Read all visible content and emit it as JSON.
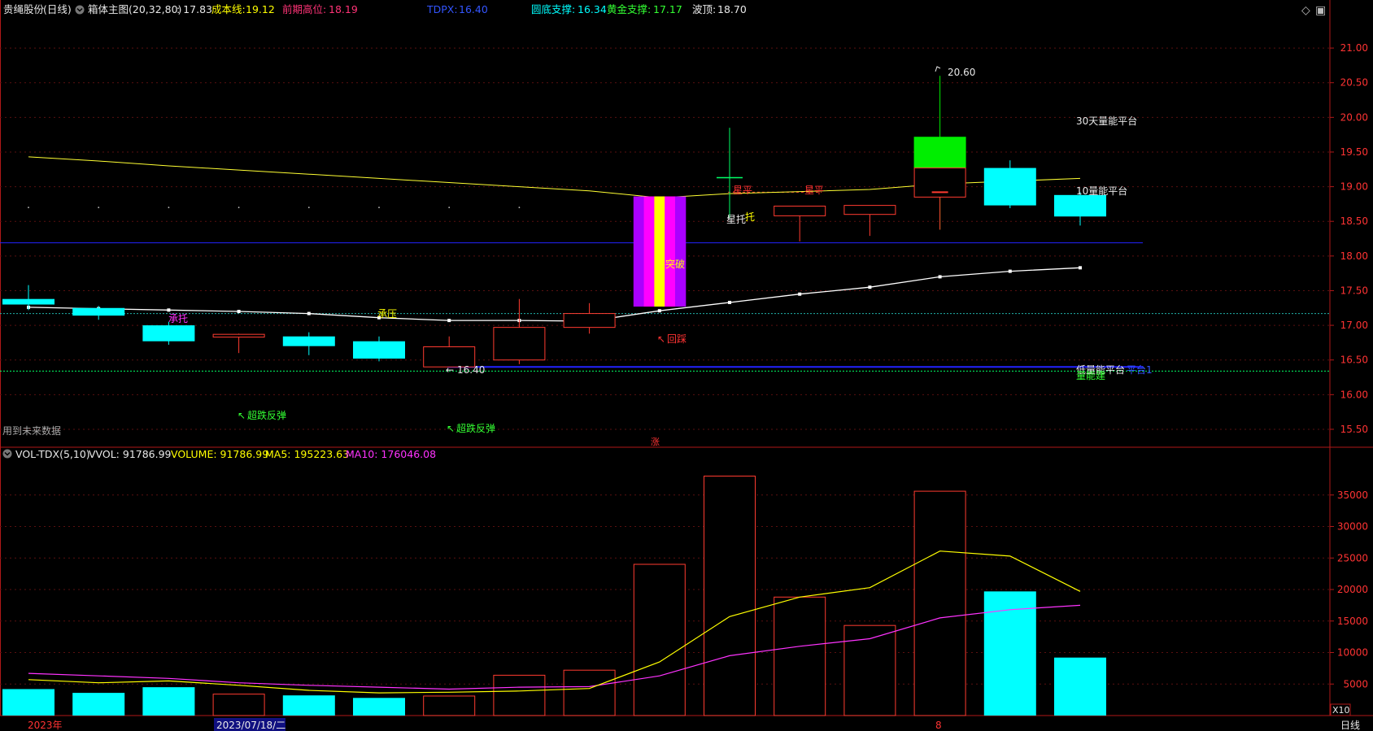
{
  "colors": {
    "bg": "#000000",
    "frame": "#b01818",
    "grid": "#5a1010",
    "up": "#ff3b30",
    "down": "#00ffff",
    "ma_price": "#ffffff",
    "cost_line": "#ffff33",
    "vol_ma5": "#ffff00",
    "vol_ma10": "#ff33ff",
    "support_line": "#00ff66",
    "blue_line": "#2222ff",
    "teal_line": "#20b2aa",
    "text_white": "#e8e8e8",
    "text_yellow": "#ffff00",
    "text_pink": "#ff3377",
    "text_blue": "#3355ff",
    "text_cyan": "#00ffff",
    "text_green": "#33ff33",
    "text_magenta": "#ff33ff",
    "text_red": "#ff3333",
    "text_gray": "#aaaaaa",
    "breakout_purple": "#aa00ff",
    "breakout_magenta": "#ff00ff",
    "breakout_yellow": "#ffff00",
    "green_candle": "#00ee00"
  },
  "header": {
    "stock_name": "贵绳股份",
    "period": "(日线)",
    "indicator": "箱体主图(20,32,80)",
    "price_value": ": 17.83",
    "cost_label": "成本线:",
    "cost_value": "19.12",
    "prev_high_label": "前期高位:",
    "prev_high_value": "18.19",
    "tdpx_label": "TDPX:",
    "tdpx_value": "16.40",
    "round_support_label": "圆底支撑:",
    "round_support_value": "16.34",
    "gold_support_label": "黄金支撑:",
    "gold_support_value": "17.17",
    "wave_top_label": "波顶:",
    "wave_top_value": "18.70",
    "diamond_icon": "◇",
    "pane_toggle_icon": "▣"
  },
  "vol_header": {
    "name": "VOL-TDX(5,10)",
    "vvol": "VVOL: 91786.99",
    "volume": "VOLUME: 91786.99",
    "ma5": "MA5: 195223.63",
    "ma10": "MA10: 176046.08"
  },
  "annotations": {
    "high_label": "20.60",
    "low_label": "16.40",
    "platform_30": "30天量能平台",
    "platform_10": "10量能平台",
    "platform_low": "低量能平台",
    "platform_blue": "平台1",
    "platform_green": "量能建",
    "star_trust": "星托",
    "star_trust2": "托",
    "breakout": "突破",
    "pullback": "回踩",
    "bearing_pressure": "承压",
    "support_trust": "承托",
    "star_flat1": "星平",
    "star_flat2": "星平",
    "rebound1": "超跌反弹",
    "rebound2": "超跌反弹",
    "future_data": "用到未来数据",
    "rise_marker": "涨"
  },
  "bottom_axis": {
    "year_label": "2023年",
    "date_label": "2023/07/18/二",
    "marker": "8",
    "unit": "X10",
    "period": "日线"
  },
  "chart_data": [
    {
      "type": "candlestick",
      "title": "箱体主图(20,32,80)",
      "ylim": [
        15.3,
        21.4
      ],
      "yticks": [
        "21.00",
        "20.50",
        "20.00",
        "19.50",
        "19.00",
        "18.50",
        "18.00",
        "17.50",
        "17.00",
        "16.50",
        "16.00",
        "15.50"
      ],
      "candles": [
        {
          "o": 17.3,
          "h": 17.58,
          "l": 17.22,
          "c": 17.38
        },
        {
          "o": 17.25,
          "h": 17.28,
          "l": 17.08,
          "c": 17.14
        },
        {
          "o": 17.0,
          "h": 17.05,
          "l": 16.72,
          "c": 16.77
        },
        {
          "o": 16.83,
          "h": 16.88,
          "l": 16.6,
          "c": 16.87
        },
        {
          "o": 16.84,
          "h": 16.9,
          "l": 16.57,
          "c": 16.7
        },
        {
          "o": 16.77,
          "h": 16.84,
          "l": 16.48,
          "c": 16.52
        },
        {
          "o": 16.4,
          "h": 16.84,
          "l": 16.4,
          "c": 16.69
        },
        {
          "o": 16.5,
          "h": 17.38,
          "l": 16.44,
          "c": 16.97
        },
        {
          "o": 16.97,
          "h": 17.32,
          "l": 16.88,
          "c": 17.17
        },
        {
          "o": 17.27,
          "h": 18.86,
          "l": 17.24,
          "c": 18.86
        },
        {
          "o": 19.13,
          "h": 19.85,
          "l": 18.55,
          "c": 19.13
        },
        {
          "o": 18.58,
          "h": 18.72,
          "l": 18.21,
          "c": 18.72
        },
        {
          "o": 18.6,
          "h": 18.73,
          "l": 18.29,
          "c": 18.73
        },
        {
          "o": 18.85,
          "h": 20.6,
          "l": 18.38,
          "c": 19.25
        },
        {
          "o": 19.27,
          "h": 19.38,
          "l": 18.69,
          "c": 18.73
        },
        {
          "o": 18.88,
          "h": 18.92,
          "l": 18.44,
          "c": 18.57
        }
      ],
      "candle_styles": [
        "down",
        "down",
        "down",
        "up",
        "down",
        "down",
        "up",
        "up",
        "up",
        "breakout",
        "cross",
        "up",
        "up",
        "green",
        "down",
        "down"
      ],
      "ma_white": [
        17.26,
        17.24,
        17.22,
        17.2,
        17.17,
        17.11,
        17.07,
        17.07,
        17.06,
        17.21,
        17.33,
        17.45,
        17.55,
        17.7,
        17.78,
        17.83
      ],
      "cost_line": [
        19.43,
        19.37,
        19.3,
        19.24,
        19.18,
        19.12,
        19.06,
        19.0,
        18.94,
        18.84,
        18.9,
        18.93,
        18.96,
        19.04,
        19.08,
        19.12
      ],
      "prev_high_line": 18.19,
      "tdpx_line": 16.4,
      "round_support_line": 16.34,
      "gold_support_line": 17.17,
      "wave_top_dots": 18.7
    },
    {
      "type": "bar",
      "title": "VOL-TDX(5,10)",
      "ylim": [
        0,
        40000
      ],
      "yticks": [
        "35000",
        "30000",
        "25000",
        "20000",
        "15000",
        "10000",
        "5000"
      ],
      "values": [
        4200,
        3600,
        4500,
        3400,
        3200,
        2800,
        3100,
        6400,
        7200,
        24000,
        38000,
        18800,
        14300,
        35600,
        19700,
        9200
      ],
      "bar_styles": [
        "down",
        "down",
        "down",
        "up",
        "down",
        "down",
        "up",
        "up",
        "up",
        "up",
        "up",
        "up",
        "up",
        "up",
        "down",
        "down"
      ],
      "ma5": [
        5700,
        5200,
        5500,
        4800,
        4000,
        3600,
        3700,
        3900,
        4300,
        8500,
        15700,
        18800,
        20300,
        26100,
        25300,
        19700
      ],
      "ma10": [
        6700,
        6300,
        5900,
        5200,
        4800,
        4500,
        4200,
        4500,
        4600,
        6300,
        9500,
        11000,
        12200,
        15500,
        16800,
        17500
      ]
    }
  ]
}
